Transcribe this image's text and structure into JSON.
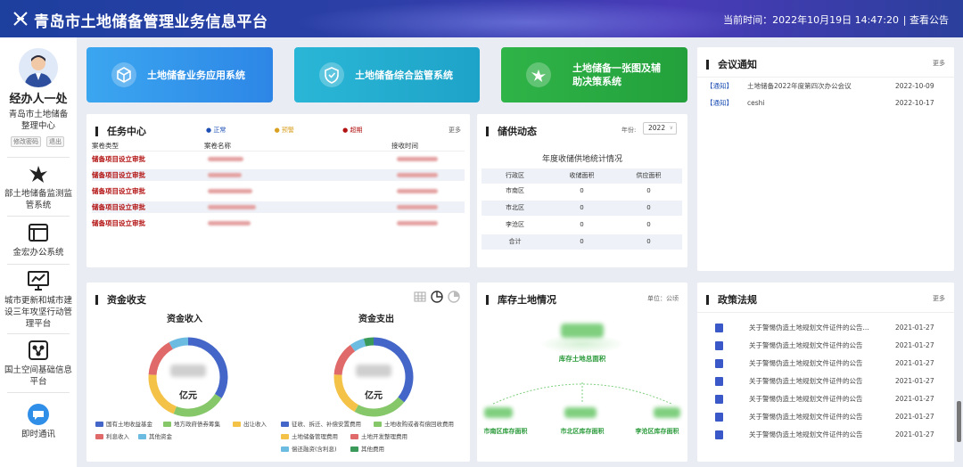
{
  "header": {
    "title": "青岛市土地储备管理业务信息平台",
    "time": "当前时间：2022年10月19日 14:47:20",
    "notice_link": "| 查看公告"
  },
  "sidebar": {
    "user_name": "经办人一处",
    "org_line1": "青岛市土地储备",
    "org_line2": "整理中心",
    "btn_edit": "修改密码",
    "btn_logout": "退出",
    "items": [
      {
        "label": "部土地储备监测监管系统",
        "icon": "bird-icon"
      },
      {
        "label": "金宏办公系统",
        "icon": "window-icon"
      },
      {
        "label": "城市更新和城市建设三年攻坚行动管理平台",
        "icon": "monitor-chart-icon"
      },
      {
        "label": "国土空间基础信息平台",
        "icon": "network-icon"
      },
      {
        "label": "即时通讯",
        "icon": "chat-icon"
      }
    ]
  },
  "systems": [
    {
      "label": "土地储备业务应用系统",
      "icon": "cube-icon"
    },
    {
      "label": "土地储备综合监管系统",
      "icon": "shield-icon"
    },
    {
      "label": "土地储备一张图及辅助决策系统",
      "icon": "bird-icon"
    }
  ],
  "tasks": {
    "title": "任务中心",
    "more": "更多",
    "legend": [
      {
        "label": "正常",
        "color": "#1d4fb4"
      },
      {
        "label": "预警",
        "color": "#d9a021"
      },
      {
        "label": "超期",
        "color": "#b31212"
      }
    ],
    "columns": [
      "案卷类型",
      "案卷名称",
      "接收时间"
    ],
    "rows": [
      {
        "type": "储备项目设立审批"
      },
      {
        "type": "储备项目设立审批"
      },
      {
        "type": "储备项目设立审批"
      },
      {
        "type": "储备项目设立审批"
      },
      {
        "type": "储备项目设立审批"
      }
    ]
  },
  "supply": {
    "title": "储供动态",
    "year_label": "年份:",
    "year": "2022",
    "subtitle": "年度收储供地统计情况",
    "columns": [
      "行政区",
      "收储面积",
      "供应面积"
    ],
    "rows": [
      [
        "市南区",
        "0",
        "0"
      ],
      [
        "市北区",
        "0",
        "0"
      ],
      [
        "李沧区",
        "0",
        "0"
      ],
      [
        "合计",
        "0",
        "0"
      ]
    ]
  },
  "meeting": {
    "title": "会议通知",
    "more": "更多",
    "items": [
      {
        "tag": "【通知】",
        "text": "土地储备2022年度第四次办公会议",
        "date": "2022-10-09"
      },
      {
        "tag": "【通知】",
        "text": "ceshi",
        "date": "2022-10-17"
      }
    ]
  },
  "funds": {
    "title": "资金收支",
    "income": {
      "title": "资金收入",
      "unit": "亿元",
      "legend": [
        {
          "label": "国有土地收益基金",
          "color": "#4466c8"
        },
        {
          "label": "地方政府债券筹集",
          "color": "#86c76a"
        },
        {
          "label": "出让收入",
          "color": "#f4c246"
        },
        {
          "label": "利息收入",
          "color": "#e06a6a"
        },
        {
          "label": "其他资金",
          "color": "#6cbbe0"
        }
      ],
      "shares": [
        0.34,
        0.22,
        0.2,
        0.16,
        0.08
      ]
    },
    "expense": {
      "title": "资金支出",
      "unit": "亿元",
      "legend": [
        {
          "label": "征收、拆迁、补偿安置费用",
          "color": "#4466c8"
        },
        {
          "label": "土地收购或者有偿回收费用",
          "color": "#86c76a"
        },
        {
          "label": "土地储备管理费用",
          "color": "#f4c246"
        },
        {
          "label": "土地开发整理费用",
          "color": "#e06a6a"
        },
        {
          "label": "偿还融资(含利息)",
          "color": "#6cbbe0"
        },
        {
          "label": "其他费用",
          "color": "#3a9a5a"
        }
      ],
      "shares": [
        0.36,
        0.22,
        0.18,
        0.14,
        0.06,
        0.04
      ]
    }
  },
  "stock": {
    "title": "库存土地情况",
    "unit": "单位：公顷",
    "total_label": "库存土地总面积",
    "districts": [
      {
        "label": "市南区库存面积"
      },
      {
        "label": "市北区库存面积"
      },
      {
        "label": "李沧区库存面积"
      }
    ]
  },
  "policy": {
    "title": "政策法规",
    "more": "更多",
    "items": [
      {
        "text": "关于警惕伪造土地规划文件证件的公告...",
        "date": "2021-01-27"
      },
      {
        "text": "关于警惕伪造土地规划文件证件的公告",
        "date": "2021-01-27"
      },
      {
        "text": "关于警惕伪造土地规划文件证件的公告",
        "date": "2021-01-27"
      },
      {
        "text": "关于警惕伪造土地规划文件证件的公告",
        "date": "2021-01-27"
      },
      {
        "text": "关于警惕伪造土地规划文件证件的公告",
        "date": "2021-01-27"
      },
      {
        "text": "关于警惕伪造土地规划文件证件的公告",
        "date": "2021-01-27"
      },
      {
        "text": "关于警惕伪造土地规划文件证件的公告",
        "date": "2021-01-27"
      }
    ]
  }
}
